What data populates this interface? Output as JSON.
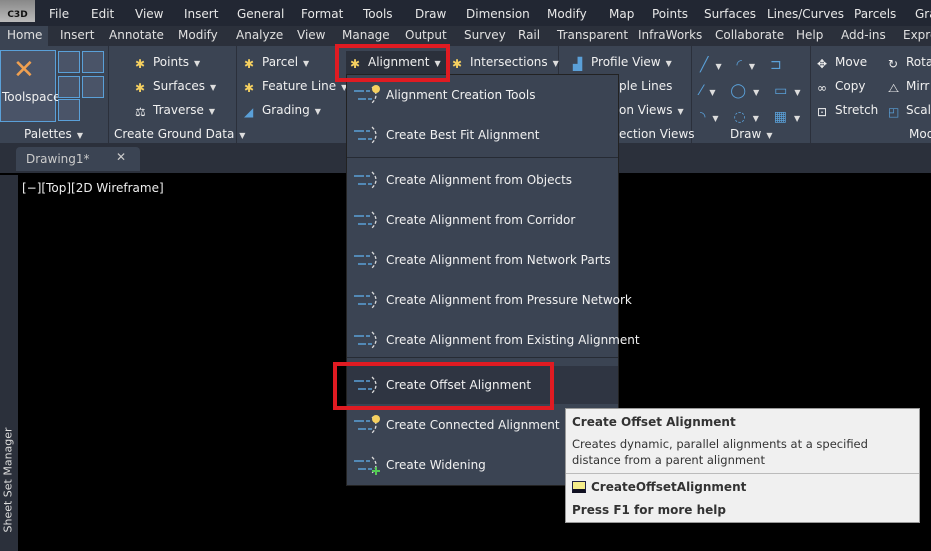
{
  "app": {
    "logo": "C3D"
  },
  "menubar": [
    "File",
    "Edit",
    "View",
    "Insert",
    "General",
    "Format",
    "Tools",
    "Draw",
    "Dimension",
    "Modify",
    "Map",
    "Points",
    "Surfaces",
    "Lines/Curves",
    "Parcels",
    "Gra"
  ],
  "tabs": [
    "Home",
    "Insert",
    "Annotate",
    "Modify",
    "Analyze",
    "View",
    "Manage",
    "Output",
    "Survey",
    "Rail",
    "Transparent",
    "InfraWorks",
    "Collaborate",
    "Help",
    "Add-ins",
    "Expre"
  ],
  "ribbon": {
    "toolspace": "Toolspace",
    "palettes": "Palettes",
    "points": "Points",
    "surfaces": "Surfaces",
    "traverse": "Traverse",
    "create_ground_data": "Create Ground Data",
    "parcel": "Parcel",
    "feature_line": "Feature Line",
    "grading": "Grading",
    "alignment": "Alignment",
    "intersections": "Intersections",
    "profile_view": "Profile View",
    "sample_lines": "ple Lines",
    "section_views": "on Views",
    "create_section_views": "ection Views",
    "draw": "Draw",
    "move": "Move",
    "copy": "Copy",
    "stretch": "Stretch",
    "rotate": "Rota",
    "mirror": "Mirr",
    "scale": "Scal",
    "modify": "Mod"
  },
  "document": {
    "tab": "Drawing1*",
    "viewport_label": "[−][Top][2D Wireframe]",
    "sheet_set_manager": "Sheet Set Manager"
  },
  "alignment_menu": [
    {
      "label": "Alignment Creation Tools",
      "icon": "alignment-creation-tools-icon"
    },
    {
      "label": "Create Best Fit Alignment",
      "icon": "best-fit-alignment-icon"
    },
    {
      "label": "Create Alignment from Objects",
      "icon": "alignment-from-objects-icon"
    },
    {
      "label": "Create Alignment from Corridor",
      "icon": "alignment-from-corridor-icon"
    },
    {
      "label": "Create Alignment from Network Parts",
      "icon": "alignment-from-network-parts-icon"
    },
    {
      "label": "Create Alignment from Pressure Network",
      "icon": "alignment-from-pressure-network-icon"
    },
    {
      "label": "Create Alignment from Existing Alignment",
      "icon": "alignment-from-existing-icon"
    },
    {
      "label": "Create Offset Alignment",
      "icon": "offset-alignment-icon",
      "highlighted": true
    },
    {
      "label": "Create Connected Alignment",
      "icon": "connected-alignment-icon"
    },
    {
      "label": "Create Widening",
      "icon": "widening-icon"
    }
  ],
  "tooltip": {
    "title": "Create Offset Alignment",
    "description": "Creates dynamic, parallel alignments at a specified distance from a parent alignment",
    "command": "CreateOffsetAlignment",
    "help": "Press F1 for more help"
  },
  "colors": {
    "highlight_box": "#e01b22",
    "ribbon": "#3b4453",
    "accent": "#5aa0d8"
  }
}
